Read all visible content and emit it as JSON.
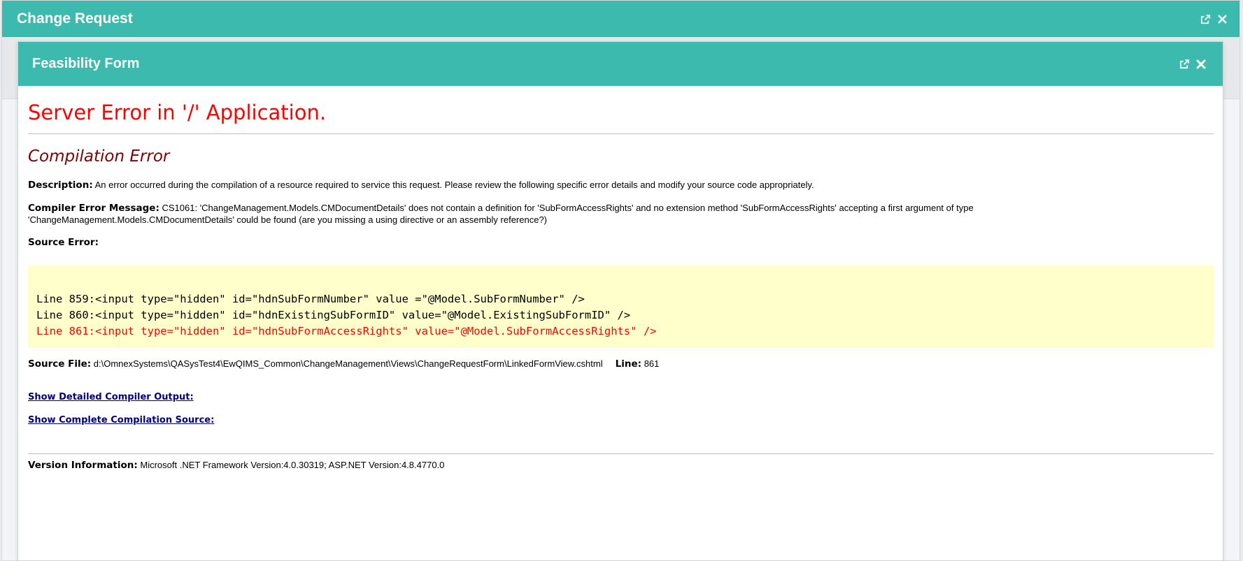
{
  "outer_window": {
    "title": "Change Request",
    "icons": [
      "external-link-icon",
      "close-icon"
    ]
  },
  "inner_window": {
    "title": "Feasibility Form",
    "icons": [
      "external-link-icon",
      "close-icon"
    ]
  },
  "error_page": {
    "title": "Server Error in '/' Application.",
    "subtitle": "Compilation Error",
    "description_label": "Description:",
    "description_text": "An error occurred during the compilation of a resource required to service this request. Please review the following specific error details and modify your source code appropriately.",
    "compiler_message_label": "Compiler Error Message:",
    "compiler_message_text": "CS1061: 'ChangeManagement.Models.CMDocumentDetails' does not contain a definition for 'SubFormAccessRights' and no extension method 'SubFormAccessRights' accepting a first argument of type 'ChangeManagement.Models.CMDocumentDetails' could be found (are you missing a using directive or an assembly reference?)",
    "source_error_label": "Source Error:",
    "source_lines": [
      "Line 859:<input type=\"hidden\" id=\"hdnSubFormNumber\" value =\"@Model.SubFormNumber\" />",
      "Line 860:<input type=\"hidden\" id=\"hdnExistingSubFormID\" value=\"@Model.ExistingSubFormID\" />",
      "Line 861:<input type=\"hidden\" id=\"hdnSubFormAccessRights\" value=\"@Model.SubFormAccessRights\" />"
    ],
    "source_file_label": "Source File:",
    "source_file_path": "d:\\OmnexSystems\\QASysTest4\\EwQIMS_Common\\ChangeManagement\\Views\\ChangeRequestForm\\LinkedFormView.cshtml",
    "line_label": "Line:",
    "line_number": "861",
    "link_detailed_output": "Show Detailed Compiler Output:",
    "link_complete_source": "Show Complete Compilation Source:",
    "version_label": "Version Information:",
    "version_text": "Microsoft .NET Framework Version:4.0.30319; ASP.NET Version:4.8.4770.0"
  },
  "colors": {
    "header_teal": "#3bbaad",
    "error_red": "#ff0000",
    "subtitle_maroon": "#800000",
    "code_background": "#ffffcc",
    "link_navy": "#000080"
  }
}
